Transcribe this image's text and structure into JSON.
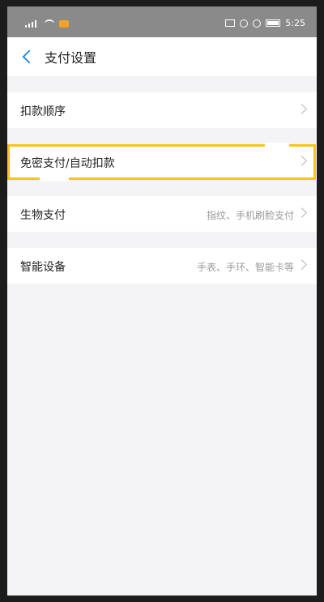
{
  "status_bar": {
    "time": "5:25"
  },
  "header": {
    "title": "支付设置"
  },
  "rows": [
    {
      "label": "扣款顺序",
      "value": ""
    },
    {
      "label": "免密支付/自动扣款",
      "value": ""
    },
    {
      "label": "生物支付",
      "value": "指纹、手机刷脸支付"
    },
    {
      "label": "智能设备",
      "value": "手表、手环、智能卡等"
    }
  ],
  "colors": {
    "accent": "#2b8fd6",
    "highlight": "#f5c518",
    "status_bar": "#8a8a8a"
  }
}
